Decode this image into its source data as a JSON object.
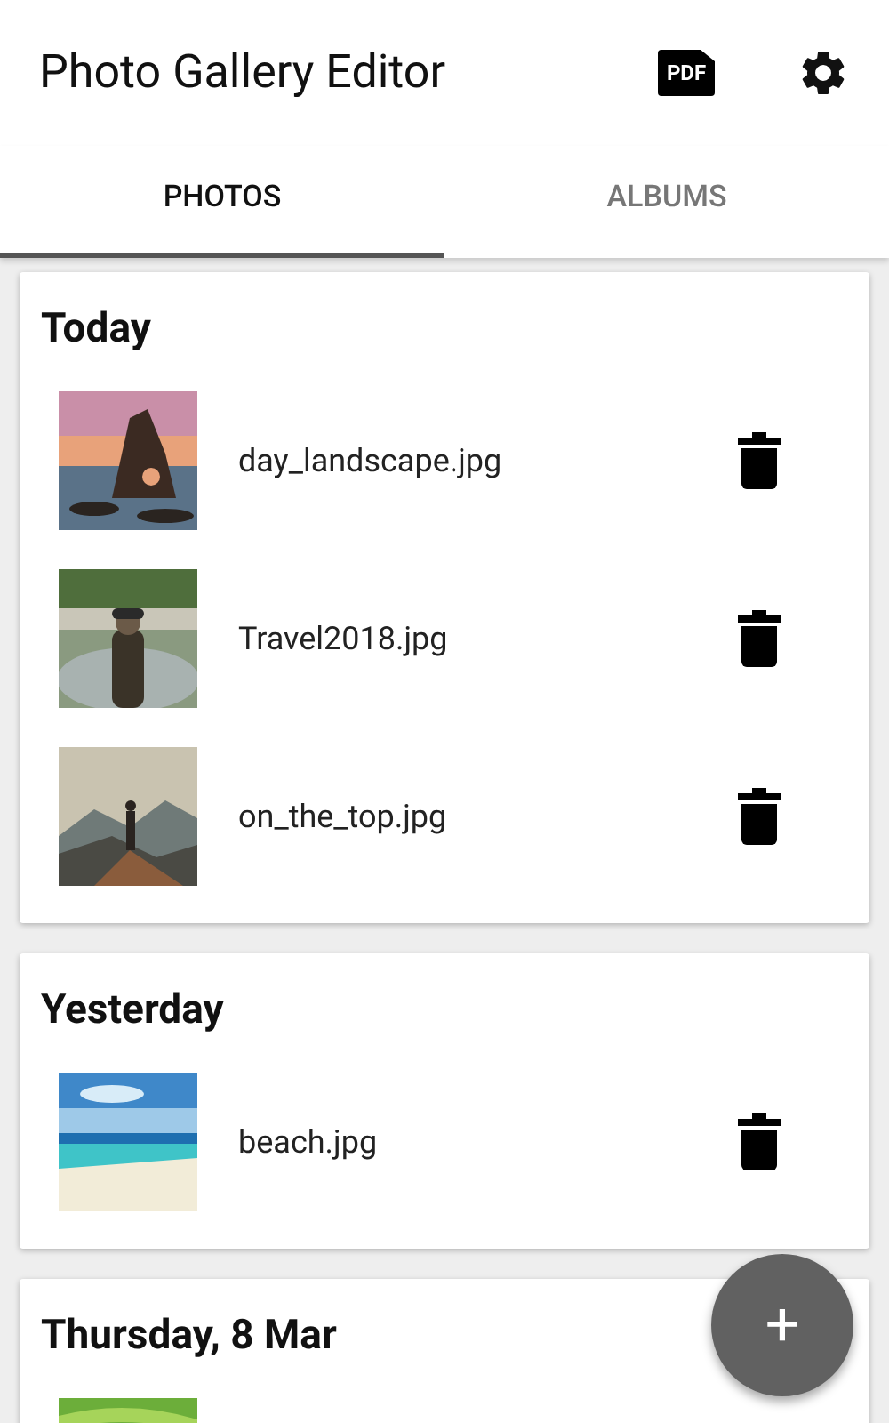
{
  "app_bar": {
    "title": "Photo Gallery Editor",
    "pdf_label": "PDF"
  },
  "tabs": [
    {
      "label": "PHOTOS",
      "selected": true
    },
    {
      "label": "ALBUMS",
      "selected": false
    }
  ],
  "sections": [
    {
      "heading": "Today",
      "photos": [
        {
          "kind": "picture",
          "name": "day_landscape.jpg"
        },
        {
          "kind": "picture",
          "name": "Travel2018.jpg"
        },
        {
          "kind": "picture",
          "name": "on_the_top.jpg"
        }
      ]
    },
    {
      "heading": "Yesterday",
      "photos": [
        {
          "kind": "picture",
          "name": "beach.jpg"
        }
      ]
    },
    {
      "heading": "Thursday, 8 Mar"
    }
  ],
  "fab": {
    "label": "+"
  }
}
